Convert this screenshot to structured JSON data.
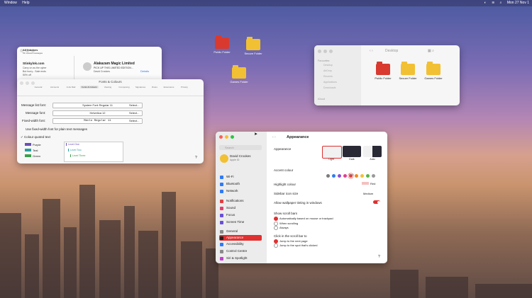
{
  "menubar": {
    "window": "Window",
    "help": "Help",
    "clock": "Mon 27 Nov 1"
  },
  "desktop_icons": [
    {
      "label": "Public Folder",
      "color": "#d83a30"
    },
    {
      "label": "Secure Folder",
      "color": "#f2c033"
    },
    {
      "label": "Games Folder",
      "color": "#f2c033"
    }
  ],
  "mail": {
    "inbox_title": "All Inboxes",
    "inbox_sub": "53 unread messages",
    "msg1_sender": "Stinkylnk.com",
    "msg1_line1": "Carry on as the cyber",
    "msg1_line2": "But hurry - Sale ends",
    "msg1_line3": "50% off",
    "msg2_sender": "Alakazam Magic Limited",
    "msg2_line1": "PICK UP THIS LIMITED EDITION...",
    "msg2_from": "David Crookes",
    "msg2_details": "Details"
  },
  "fonts_panel": {
    "title": "Fonts & Colours",
    "tabs": [
      "General",
      "Accounts",
      "Junk Mail",
      "Fonts & Colours",
      "Viewing",
      "Composing",
      "Signatures",
      "Rules",
      "Extensions",
      "Privacy"
    ],
    "rows": [
      {
        "label": "Message list font:",
        "value": "System Font Regular 11",
        "button": "Select..."
      },
      {
        "label": "Message font:",
        "value": "Helvetica 12",
        "button": "Select..."
      },
      {
        "label": "Fixed-width font:",
        "value": "Menlo Regular 11",
        "button": "Select..."
      }
    ],
    "fixed_width_checkbox": "Use fixed-width font for plain text messages",
    "quoted_checkbox": "Colour quoted text",
    "quote_colors": [
      {
        "name": "Purple",
        "color": "#6a4fb8"
      },
      {
        "name": "Teal",
        "color": "#2a9fa0"
      },
      {
        "name": "Green",
        "color": "#3aa04a"
      }
    ],
    "levels": [
      "Level One",
      "Level Two",
      "Level Three"
    ],
    "help": "?"
  },
  "finder": {
    "title": "Desktop",
    "sidebar_favourites": "Favourites",
    "sidebar_items": [
      "Desktop",
      "AirDrop",
      "Recents",
      "Applications",
      "Downloads"
    ],
    "sidebar_cloud": "iCloud",
    "folders": [
      {
        "label": "Public Folder",
        "color": "#d83a30"
      },
      {
        "label": "Secure Folder",
        "color": "#f2c033"
      },
      {
        "label": "Games Folder",
        "color": "#f2c033"
      }
    ]
  },
  "settings": {
    "title": "Appearance",
    "search_placeholder": "Search",
    "user_name": "David Crookes",
    "user_sub": "Apple ID",
    "sidebar": [
      {
        "label": "Wi-Fi",
        "color": "#2f7bf6"
      },
      {
        "label": "Bluetooth",
        "color": "#2f7bf6"
      },
      {
        "label": "Network",
        "color": "#2f7bf6"
      },
      {
        "label": "Notifications",
        "color": "#e04040"
      },
      {
        "label": "Sound",
        "color": "#e04070"
      },
      {
        "label": "Focus",
        "color": "#6a4fd8"
      },
      {
        "label": "Screen Time",
        "color": "#6a4fd8"
      },
      {
        "label": "General",
        "color": "#8a8a8a"
      },
      {
        "label": "Appearance",
        "color": "#222222"
      },
      {
        "label": "Accessibility",
        "color": "#2f7bf6"
      },
      {
        "label": "Control Centre",
        "color": "#8a8a8a"
      },
      {
        "label": "Siri & Spotlight",
        "color": "#c040d0"
      }
    ],
    "appearance_label": "Appearance",
    "themes": [
      "Light",
      "Dark",
      "Auto"
    ],
    "accent_label": "Accent colour",
    "accent_colors": [
      "#7b7b7b",
      "#2f7bf6",
      "#8e4fd8",
      "#e0408f",
      "#e04040",
      "#f08a24",
      "#f2c033",
      "#5ab34a",
      "#999999"
    ],
    "accent_selected": "Red",
    "highlight_label": "Highlight colour",
    "highlight_value": "Red",
    "sidebar_icon_label": "Sidebar icon size",
    "sidebar_icon_value": "Medium",
    "tinting_label": "Allow wallpaper tinting in windows",
    "scroll_label": "Show scroll bars",
    "scroll_options": [
      "Automatically based on mouse or trackpad",
      "When scrolling",
      "Always"
    ],
    "click_label": "Click in the scroll bar to",
    "click_options": [
      "Jump to the next page",
      "Jump to the spot that's clicked"
    ],
    "help": "?"
  }
}
